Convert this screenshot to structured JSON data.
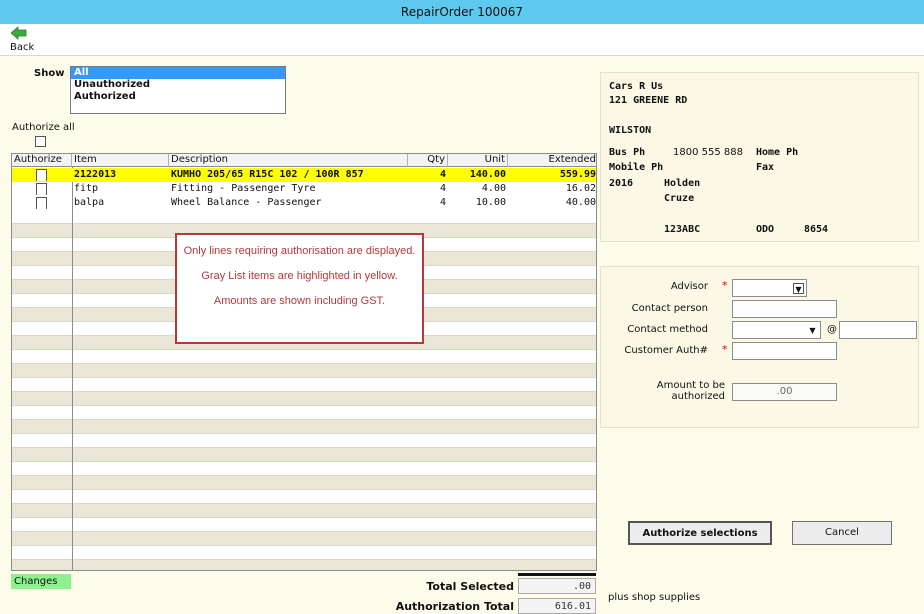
{
  "window": {
    "title": "RepairOrder  100067"
  },
  "toolbar": {
    "back_label": "Back"
  },
  "filter": {
    "show_label": "Show",
    "options": [
      "All",
      "Unauthorized",
      "Authorized"
    ],
    "selected": "All"
  },
  "authorize_all_label": "Authorize all",
  "grid": {
    "headers": {
      "authorize": "Authorize",
      "item": "Item",
      "description": "Description",
      "qty": "Qty",
      "unit": "Unit",
      "extended": "Extended"
    },
    "rows": [
      {
        "item": "2122013",
        "description": "KUMHO 205/65 R15C 102 / 100R 857",
        "qty": "4",
        "unit": "140.00",
        "extended": "559.99",
        "highlight": true
      },
      {
        "item": "fitp",
        "description": "Fitting - Passenger Tyre",
        "qty": "4",
        "unit": "4.00",
        "extended": "16.02",
        "highlight": false
      },
      {
        "item": "balpa",
        "description": "Wheel Balance - Passenger",
        "qty": "4",
        "unit": "10.00",
        "extended": "40.00",
        "highlight": false
      }
    ]
  },
  "notice": {
    "line1": "Only lines requiring authorisation are displayed.",
    "line2": "Gray List items are highlighted in yellow.",
    "line3": "Amounts are shown including GST."
  },
  "changes_label": "Changes",
  "totals": {
    "selected_label": "Total Selected",
    "selected_value": ".00",
    "auth_label": "Authorization Total",
    "auth_value": "616.01"
  },
  "customer": {
    "name": "Cars R Us",
    "address": "121 GREENE RD",
    "suburb": "WILSTON",
    "bus_ph_label": "Bus Ph",
    "bus_ph": "1800 555 888",
    "home_ph_label": "Home Ph",
    "mobile_ph_label": "Mobile Ph",
    "fax_label": "Fax",
    "year": "2016",
    "make": "Holden",
    "model": "Cruze",
    "rego": "123ABC",
    "odo_label": "ODO",
    "odo": "8654"
  },
  "form": {
    "advisor_label": "Advisor",
    "contact_person_label": "Contact person",
    "contact_method_label": "Contact method",
    "at_symbol": "@",
    "customer_auth_label": "Customer Auth#",
    "amount_label_1": "Amount to be",
    "amount_label_2": "authorized",
    "amount_value": ".00"
  },
  "buttons": {
    "authorize": "Authorize selections",
    "cancel": "Cancel"
  },
  "shop_supplies_label": "plus shop supplies",
  "colors": {
    "titlebar": "#5fc8ee",
    "highlight": "#fffe00",
    "notice_border": "#b23a3a",
    "changes": "#8ef08e",
    "selection": "#3399ff"
  }
}
